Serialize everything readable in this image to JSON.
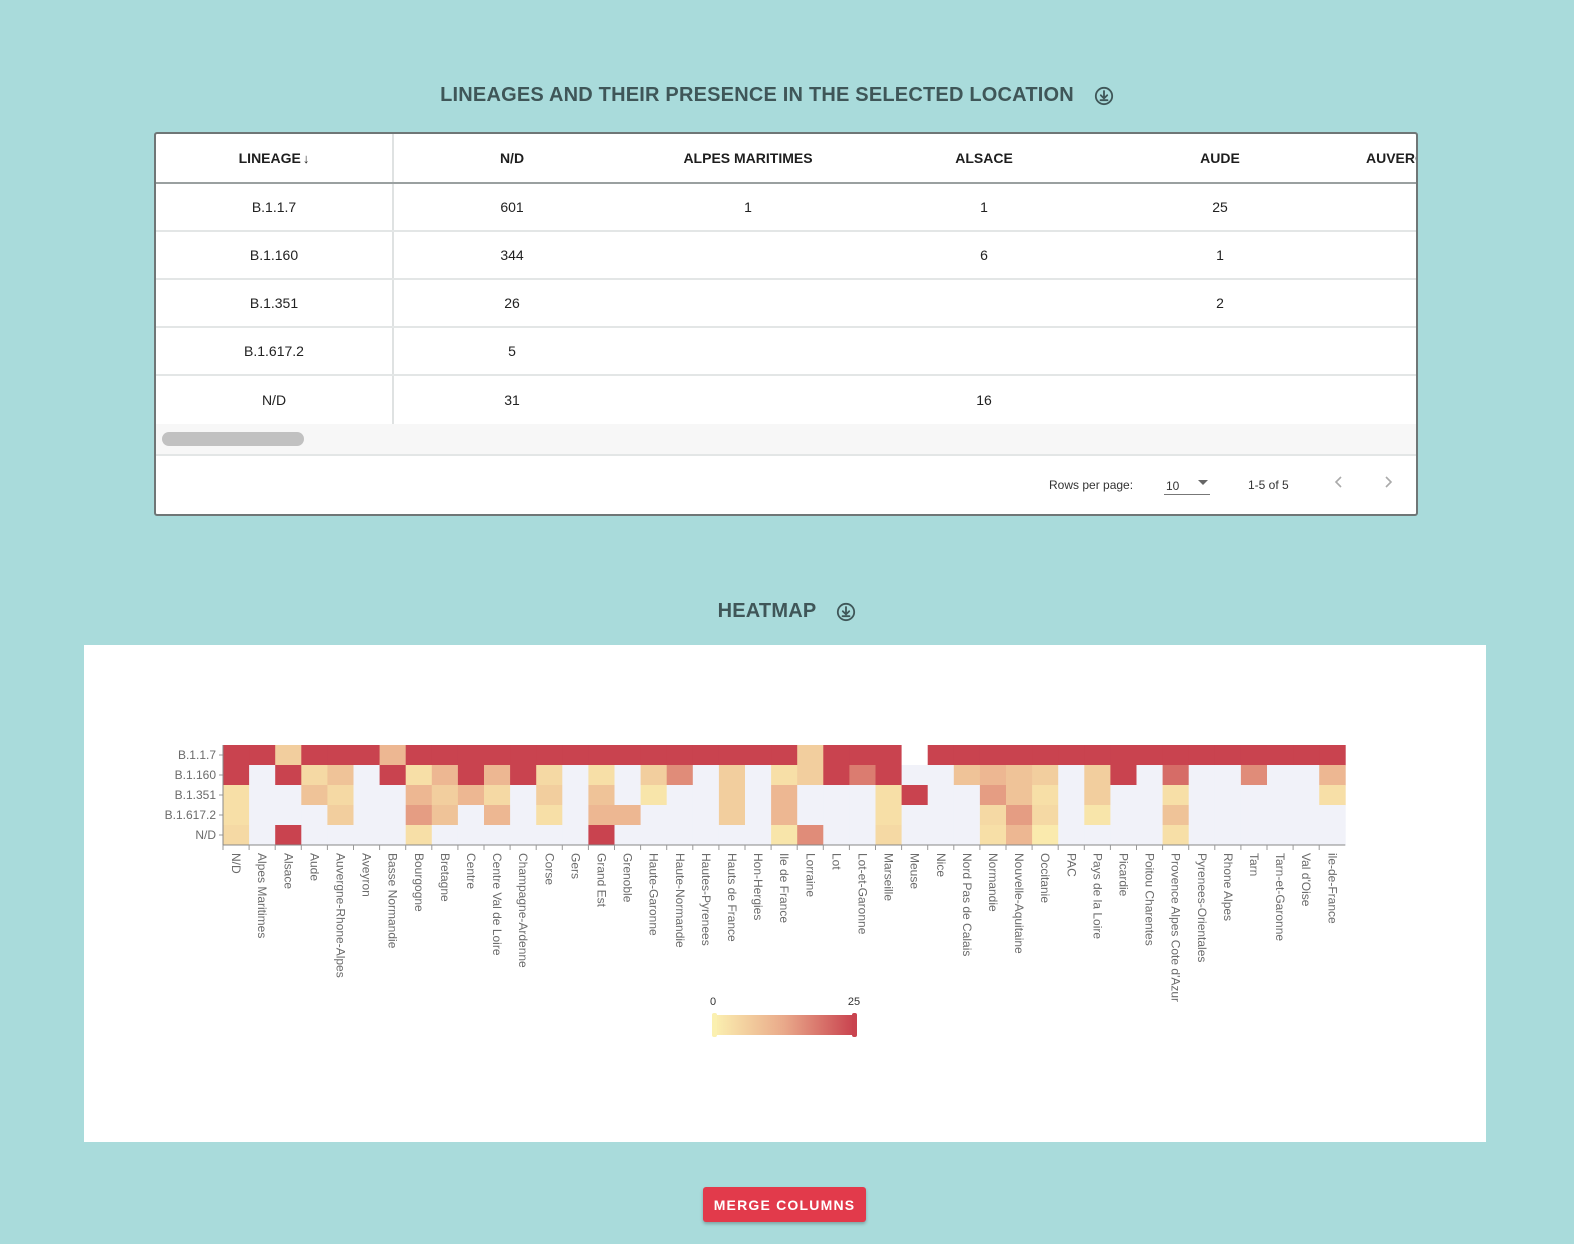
{
  "table_section": {
    "title": "LINEAGES AND THEIR PRESENCE IN THE SELECTED LOCATION",
    "columns": [
      "LINEAGE",
      "N/D",
      "ALPES MARITIMES",
      "ALSACE",
      "AUDE",
      "AUVERG"
    ],
    "rows": [
      [
        "B.1.1.7",
        "601",
        "1",
        "1",
        "25",
        ""
      ],
      [
        "B.1.160",
        "344",
        "",
        "6",
        "1",
        ""
      ],
      [
        "B.1.351",
        "26",
        "",
        "",
        "2",
        ""
      ],
      [
        "B.1.617.2",
        "5",
        "",
        "",
        "",
        ""
      ],
      [
        "N/D",
        "31",
        "",
        "16",
        "",
        ""
      ]
    ],
    "rows_per_page_label": "Rows per page:",
    "rows_per_page_value": "10",
    "page_range": "1-5 of 5"
  },
  "heatmap_section": {
    "title": "HEATMAP"
  },
  "chart_data": {
    "type": "heatmap",
    "title": "",
    "y_categories": [
      "B.1.1.7",
      "B.1.160",
      "B.1.351",
      "B.1.617.2",
      "N/D"
    ],
    "x_categories": [
      "N/D",
      "Alpes Maritimes",
      "Alsace",
      "Aude",
      "Auvergne-Rhone-Alpes",
      "Aveyron",
      "Basse Normandie",
      "Bourgogne",
      "Bretagne",
      "Centre",
      "Centre Val de Loire",
      "Champagne-Ardenne",
      "Corse",
      "Gers",
      "Grand Est",
      "Grenoble",
      "Haute-Garonne",
      "Haute-Normandie",
      "Hautes-Pyrenees",
      "Hauts de France",
      "Hon-Hergies",
      "Ile de France",
      "Lorraine",
      "Lot",
      "Lot-et-Garonne",
      "Marseille",
      "Meuse",
      "Nice",
      "Nord Pas de Calais",
      "Normandie",
      "Nouvelle-Aquitaine",
      "Occitanie",
      "PAC",
      "Pays de la Loire",
      "Picardie",
      "Poitou Charentes",
      "Provence Alpes Cote d'Azur",
      "Pyrenees-Orientales",
      "Rhone Alpes",
      "Tarn",
      "Tarn-et-Garonne",
      "Val d'Oise",
      "ile-de-France"
    ],
    "values": [
      [
        25,
        25,
        6,
        25,
        25,
        25,
        10,
        25,
        25,
        25,
        25,
        25,
        25,
        25,
        25,
        25,
        25,
        25,
        25,
        25,
        25,
        25,
        6,
        25,
        25,
        25,
        null,
        25,
        25,
        25,
        25,
        25,
        25,
        25,
        25,
        25,
        25,
        25,
        25,
        25,
        25,
        25,
        25
      ],
      [
        25,
        0,
        25,
        4,
        8,
        0,
        25,
        3,
        10,
        25,
        10,
        25,
        4,
        0,
        3,
        0,
        6,
        16,
        0,
        6,
        0,
        3,
        6,
        25,
        18,
        25,
        0,
        0,
        8,
        10,
        8,
        6,
        0,
        6,
        25,
        0,
        20,
        0,
        0,
        16,
        0,
        0,
        10
      ],
      [
        3,
        0,
        0,
        8,
        4,
        0,
        0,
        10,
        6,
        10,
        4,
        0,
        6,
        0,
        8,
        0,
        2,
        0,
        0,
        6,
        0,
        10,
        0,
        0,
        0,
        3,
        25,
        0,
        0,
        14,
        8,
        3,
        0,
        6,
        0,
        0,
        3,
        0,
        0,
        0,
        0,
        0,
        3
      ],
      [
        3,
        0,
        0,
        0,
        6,
        0,
        0,
        14,
        8,
        0,
        10,
        0,
        3,
        0,
        10,
        10,
        0,
        0,
        0,
        6,
        0,
        10,
        0,
        0,
        0,
        3,
        0,
        0,
        0,
        4,
        14,
        4,
        0,
        2,
        0,
        0,
        8,
        0,
        0,
        0,
        0,
        0,
        0
      ],
      [
        4,
        0,
        25,
        0,
        0,
        0,
        0,
        3,
        0,
        0,
        0,
        0,
        0,
        0,
        25,
        0,
        0,
        0,
        0,
        0,
        0,
        2,
        16,
        0,
        0,
        4,
        0,
        0,
        0,
        3,
        10,
        1,
        0,
        0,
        0,
        0,
        3,
        0,
        0,
        0,
        0,
        0,
        0
      ]
    ],
    "colorbar": {
      "min": 0,
      "max": 25,
      "min_label": "0",
      "max_label": "25"
    },
    "colors": {
      "low": "#fbf0b0",
      "mid": "#e9a98a",
      "high": "#c9434f",
      "zero": "#f1f2f9",
      "empty": "#ffffff"
    }
  },
  "merge_button": {
    "label": "MERGE COLUMNS"
  },
  "colors": {
    "background": "#a9dbdb",
    "title": "#3f5658",
    "button": "#e23a4b"
  }
}
